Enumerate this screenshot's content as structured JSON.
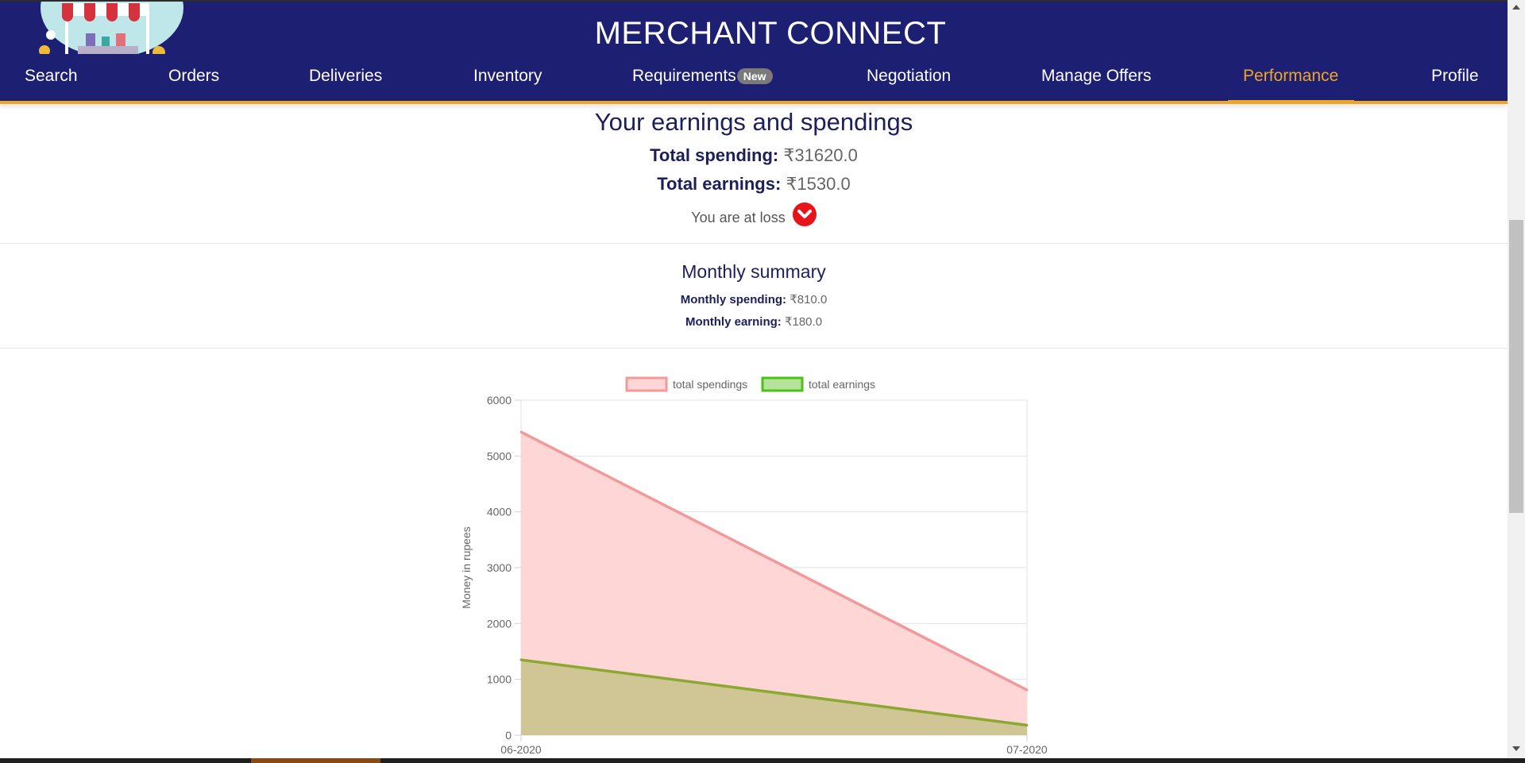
{
  "app": {
    "title": "MERCHANT CONNECT"
  },
  "nav": {
    "items": [
      {
        "label": "Search"
      },
      {
        "label": "Orders"
      },
      {
        "label": "Deliveries"
      },
      {
        "label": "Inventory"
      },
      {
        "label": "Requirements",
        "badge": "New"
      },
      {
        "label": "Negotiation"
      },
      {
        "label": "Manage Offers"
      },
      {
        "label": "Performance",
        "active": true
      },
      {
        "label": "Profile"
      }
    ]
  },
  "summary": {
    "title": "Your earnings and spendings",
    "total_spending_label": "Total spending:",
    "total_spending_value": "₹31620.0",
    "total_earnings_label": "Total earnings:",
    "total_earnings_value": "₹1530.0",
    "status_text": "You are at loss",
    "status_icon": "chevron-down-circle-icon"
  },
  "monthly": {
    "title": "Monthly summary",
    "spending_label": "Monthly spending:",
    "spending_value": "₹810.0",
    "earning_label": "Monthly earning:",
    "earning_value": "₹180.0"
  },
  "colors": {
    "header_bg": "#1c1f72",
    "accent": "#f0a526",
    "spending_line": "#f29a9a",
    "spending_fill": "#ffd6d6",
    "earnings_line": "#8aa832",
    "earnings_fill": "#cfc595",
    "loss_icon": "#e8141c"
  },
  "chart_data": {
    "type": "area",
    "x": [
      "06-2020",
      "07-2020"
    ],
    "series": [
      {
        "name": "total spendings",
        "values": [
          5430,
          810
        ]
      },
      {
        "name": "total earnings",
        "values": [
          1350,
          180
        ]
      }
    ],
    "ylabel": "Money in rupees",
    "xlabel": "",
    "ylim": [
      0,
      6000
    ],
    "yticks": [
      0,
      1000,
      2000,
      3000,
      4000,
      5000,
      6000
    ],
    "legend": "top",
    "grid": true
  }
}
